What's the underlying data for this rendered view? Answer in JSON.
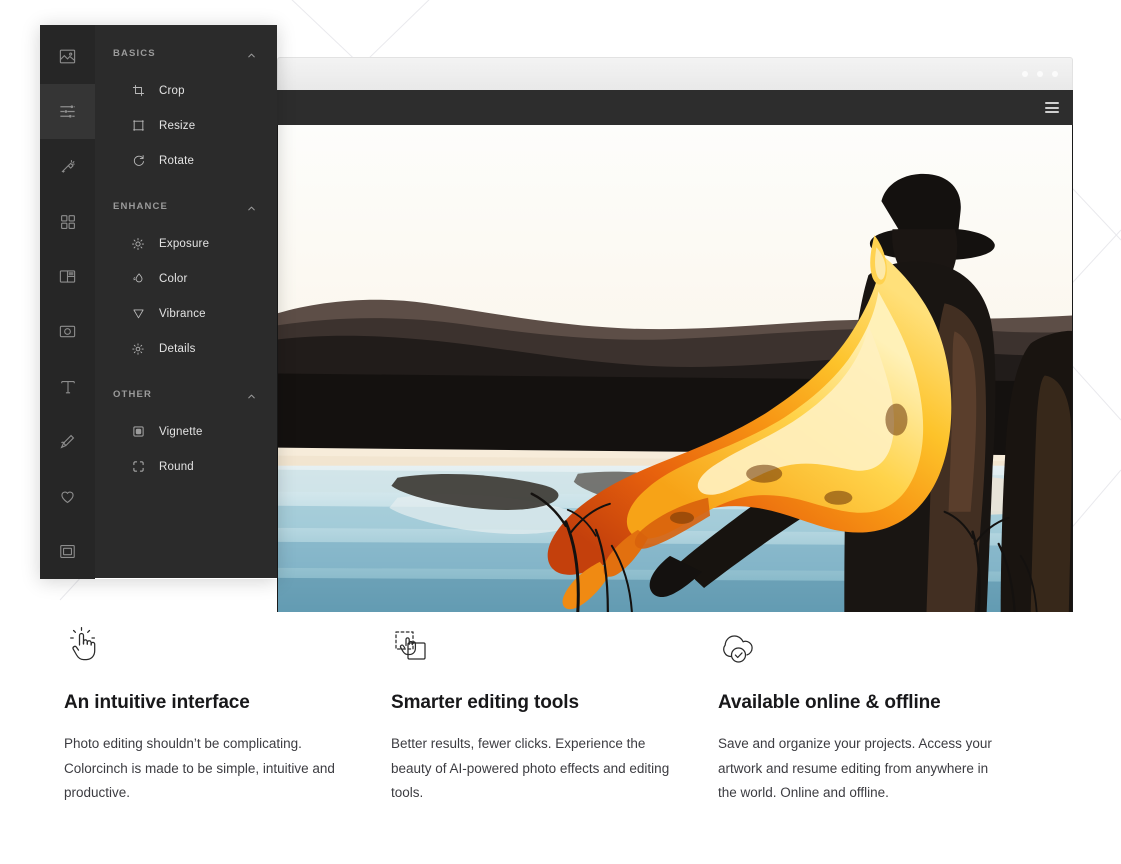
{
  "window": {
    "dots_count": 3,
    "menu_icon": "hamburger-icon"
  },
  "editor": {
    "rail": [
      {
        "id": "photo",
        "icon": "image-icon",
        "active": false
      },
      {
        "id": "adjust",
        "icon": "sliders-icon",
        "active": true
      },
      {
        "id": "effects",
        "icon": "magic-wand-icon",
        "active": false
      },
      {
        "id": "overlays",
        "icon": "grid-icon",
        "active": false
      },
      {
        "id": "frames",
        "icon": "layout-icon",
        "active": false
      },
      {
        "id": "camera",
        "icon": "camera-icon",
        "active": false
      },
      {
        "id": "text",
        "icon": "text-t-icon",
        "active": false
      },
      {
        "id": "draw",
        "icon": "brush-icon",
        "active": false
      },
      {
        "id": "favorites",
        "icon": "heart-icon",
        "active": false
      },
      {
        "id": "border",
        "icon": "square-frame-icon",
        "active": false
      }
    ],
    "groups": [
      {
        "title": "BASICS",
        "collapse_icon": "chevron-up-icon",
        "items": [
          {
            "label": "Crop",
            "icon": "crop-icon"
          },
          {
            "label": "Resize",
            "icon": "resize-icon"
          },
          {
            "label": "Rotate",
            "icon": "rotate-icon"
          }
        ]
      },
      {
        "title": "ENHANCE",
        "collapse_icon": "chevron-up-icon",
        "items": [
          {
            "label": "Exposure",
            "icon": "sun-icon"
          },
          {
            "label": "Color",
            "icon": "droplet-icon"
          },
          {
            "label": "Vibrance",
            "icon": "triangle-down-icon"
          },
          {
            "label": "Details",
            "icon": "detail-sun-icon"
          }
        ]
      },
      {
        "title": "OTHER",
        "collapse_icon": "chevron-up-icon",
        "items": [
          {
            "label": "Vignette",
            "icon": "vignette-icon"
          },
          {
            "label": "Round",
            "icon": "round-corners-icon"
          }
        ]
      }
    ]
  },
  "features": [
    {
      "icon": "click-hand-icon",
      "title": "An intuitive interface",
      "body": "Photo editing shouldn’t be complicating. Colorcinch is made to be simple, intuitive and productive."
    },
    {
      "icon": "select-object-icon",
      "title": "Smarter editing tools",
      "body": "Better results, fewer clicks. Experience the beauty of AI-powered photo effects and editing tools."
    },
    {
      "icon": "cloud-check-icon",
      "title": "Available online & offline",
      "body": "Save and organize your projects. Access your artwork and resume editing from anywhere in the world. Online and offline."
    }
  ],
  "colors": {
    "panel_bg": "#2b2b2b",
    "rail_bg": "#262626",
    "rail_active": "#353535",
    "toolbar_bg": "#2d2d2d",
    "heading": "#18181a",
    "body_text": "#3c3c41"
  }
}
